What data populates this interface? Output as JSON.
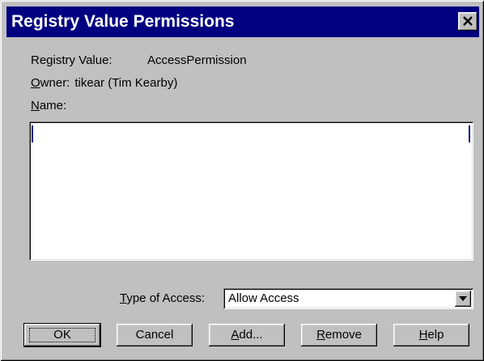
{
  "window": {
    "title": "Registry Value Permissions"
  },
  "info": {
    "registry_value_label": "Registry Value:",
    "registry_value": "AccessPermission",
    "owner_key": "O",
    "owner_rest": "wner:",
    "owner_value": "tikear (Tim Kearby)",
    "name_key": "N",
    "name_rest": "ame:"
  },
  "type_of_access": {
    "label_key": "T",
    "label_rest": "ype of Access:",
    "selected": "Allow Access"
  },
  "buttons": {
    "ok": {
      "label": "OK"
    },
    "cancel": {
      "label": "Cancel"
    },
    "add": {
      "key": "A",
      "rest": "dd..."
    },
    "remove": {
      "key": "R",
      "rest": "emove"
    },
    "help": {
      "key": "H",
      "rest": "elp"
    }
  },
  "icons": {
    "close": "close-icon",
    "dropdown": "dropdown-arrow-icon"
  },
  "colors": {
    "title_bar": "#000080",
    "title_text": "#ffffff",
    "face": "#c0c0c0",
    "list_background": "#ffffff",
    "focus_marker": "#000080"
  }
}
